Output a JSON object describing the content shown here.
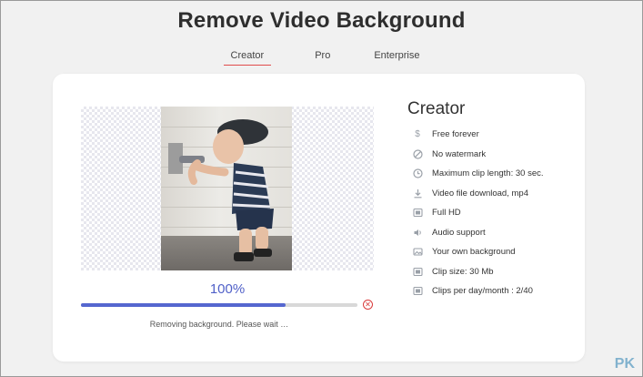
{
  "page": {
    "title": "Remove Video Background"
  },
  "tabs": [
    {
      "label": "Creator",
      "active": true
    },
    {
      "label": "Pro",
      "active": false
    },
    {
      "label": "Enterprise",
      "active": false
    }
  ],
  "progress": {
    "percent_text": "100%",
    "fill_fraction": 0.74,
    "status": "Removing background. Please wait …"
  },
  "plan": {
    "title": "Creator",
    "features": [
      {
        "icon": "dollar-icon",
        "label": "Free forever"
      },
      {
        "icon": "no-watermark-icon",
        "label": "No watermark"
      },
      {
        "icon": "clock-icon",
        "label": "Maximum clip length: 30 sec."
      },
      {
        "icon": "download-icon",
        "label": "Video file download, mp4"
      },
      {
        "icon": "hd-icon",
        "label": "Full HD"
      },
      {
        "icon": "audio-icon",
        "label": "Audio support"
      },
      {
        "icon": "image-icon",
        "label": "Your own background"
      },
      {
        "icon": "size-icon",
        "label": "Clip size: 30 Mb"
      },
      {
        "icon": "clips-icon",
        "label": "Clips per day/month : 2/40"
      }
    ]
  },
  "watermark": "PK",
  "colors": {
    "accent": "#5567cf",
    "tab_underline": "#e04c4c",
    "cancel": "#d93b3b"
  }
}
